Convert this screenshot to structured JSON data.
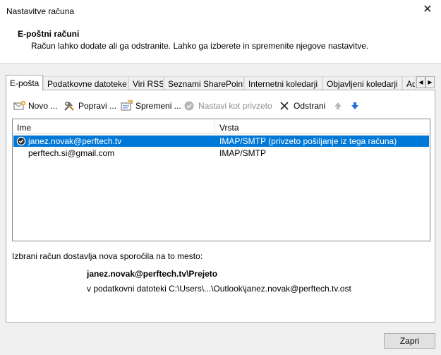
{
  "window": {
    "title": "Nastavitve računa"
  },
  "header": {
    "title": "E-poštni računi",
    "subtitle": "Račun lahko dodate ali ga odstranite. Lahko ga izberete in spremenite njegove nastavitve."
  },
  "tabs": [
    {
      "label": "E-pošta",
      "active": true
    },
    {
      "label": "Podatkovne datoteke"
    },
    {
      "label": "Viri RSS"
    },
    {
      "label": "Seznami SharePoint"
    },
    {
      "label": "Internetni koledarji"
    },
    {
      "label": "Objavljeni koledarji"
    },
    {
      "label": "Ad"
    }
  ],
  "toolbar": {
    "new_label": "Novo ...",
    "repair_label": "Popravi ...",
    "change_label": "Spremeni ...",
    "default_label": "Nastavi kot privzeto",
    "remove_label": "Odstrani"
  },
  "list": {
    "col_name": "Ime",
    "col_type": "Vrsta",
    "rows": [
      {
        "name": "janez.novak@perftech.tv",
        "type": "IMAP/SMTP (privzeto pošiljanje iz tega računa)",
        "selected": true,
        "default": true
      },
      {
        "name": "perftech.si@gmail.com",
        "type": "IMAP/SMTP",
        "selected": false,
        "default": false
      }
    ]
  },
  "delivery": {
    "label": "Izbrani račun dostavlja nova sporočila na to mesto:",
    "folder": "janez.novak@perftech.tv\\Prejeto",
    "file": "v podatkovni datoteki C:\\Users\\...\\Outlook\\janez.novak@perftech.tv.ost"
  },
  "footer": {
    "close_label": "Zapri"
  },
  "colors": {
    "selection": "#0078d7",
    "accent_arrow": "#1e6fd9"
  }
}
